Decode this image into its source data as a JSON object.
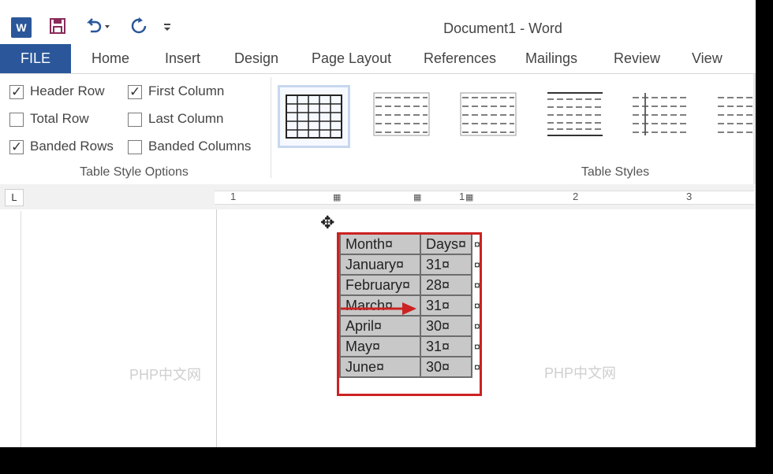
{
  "window": {
    "title": "Document1 - Word"
  },
  "quick_access": [
    "word-logo",
    "save-icon",
    "undo-icon",
    "redo-icon",
    "customize-icon"
  ],
  "word_logo_letter": "W",
  "tabs": {
    "file": "FILE",
    "items": [
      "Home",
      "Insert",
      "Design",
      "Page Layout",
      "References",
      "Mailings",
      "Review",
      "View"
    ]
  },
  "table_style_options": {
    "group_label": "Table Style Options",
    "header_row": {
      "label": "Header Row",
      "checked": true
    },
    "first_column": {
      "label": "First Column",
      "checked": true
    },
    "total_row": {
      "label": "Total Row",
      "checked": false
    },
    "last_column": {
      "label": "Last Column",
      "checked": false
    },
    "banded_rows": {
      "label": "Banded Rows",
      "checked": true
    },
    "banded_columns": {
      "label": "Banded Columns",
      "checked": false
    }
  },
  "table_styles": {
    "group_label": "Table Styles"
  },
  "ruler": {
    "corner": "L",
    "numbers": [
      "1",
      "1",
      "2",
      "3"
    ]
  },
  "table": {
    "rows": [
      [
        "Month¤",
        "Days¤",
        "¤"
      ],
      [
        "January¤",
        "31¤",
        "¤"
      ],
      [
        "February¤",
        "28¤",
        "¤"
      ],
      [
        "March¤",
        "31¤",
        "¤"
      ],
      [
        "April¤",
        "30¤",
        "¤"
      ],
      [
        "May¤",
        "31¤",
        "¤"
      ],
      [
        "June¤",
        "30¤",
        "¤"
      ]
    ]
  },
  "watermark": "PHP中文网",
  "colors": {
    "accent": "#2b579a",
    "highlight": "#cc2222"
  }
}
